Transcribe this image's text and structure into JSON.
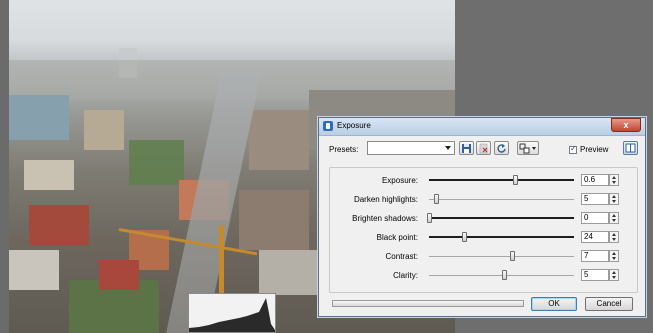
{
  "dialog": {
    "title": "Exposure",
    "close_glyph": "x",
    "presets_label": "Presets:",
    "presets_value": "",
    "preview_label": "Preview",
    "preview_checked": true,
    "ok_label": "OK",
    "cancel_label": "Cancel",
    "progress": 0,
    "icons": [
      "exposure-app-icon",
      "save-preset-icon",
      "delete-preset-icon",
      "reset-icon",
      "compare-view-icon",
      "layout-toggle-icon"
    ]
  },
  "controls": [
    {
      "label": "Exposure:",
      "value": "0.6",
      "slider": 0.59,
      "track": "dark"
    },
    {
      "label": "Darken highlights:",
      "value": "5",
      "slider": 0.05,
      "track": "light"
    },
    {
      "label": "Brighten shadows:",
      "value": "0",
      "slider": 0.0,
      "track": "dark"
    },
    {
      "label": "Black point:",
      "value": "24",
      "slider": 0.24,
      "track": "dark"
    },
    {
      "label": "Contrast:",
      "value": "7",
      "slider": 0.57,
      "track": "light"
    },
    {
      "label": "Clarity:",
      "value": "5",
      "slider": 0.52,
      "track": "light"
    }
  ],
  "colors": {
    "accent": "#2c6fb8",
    "close": "#c0452f",
    "crane": "#c68a2c"
  }
}
